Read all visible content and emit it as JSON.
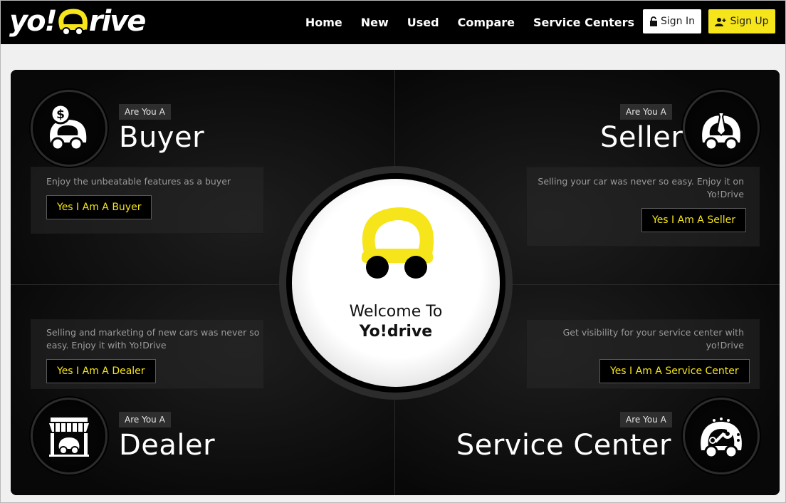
{
  "header": {
    "logo_text_1": "yo!",
    "logo_text_2": "rive",
    "nav": [
      "Home",
      "New",
      "Used",
      "Compare",
      "Service Centers"
    ],
    "sign_in": "Sign In",
    "sign_up": "Sign Up"
  },
  "colors": {
    "accent": "#f5e51a",
    "background": "#000000"
  },
  "roles": {
    "buyer": {
      "tag": "Are You A",
      "title": "Buyer",
      "desc": "Enjoy the unbeatable features as a buyer",
      "cta": "Yes I Am A Buyer",
      "icon": "buyer-car-dollar-icon"
    },
    "seller": {
      "tag": "Are You A",
      "title": "Seller",
      "desc": "Selling your car was never so easy. Enjoy it on Yo!Drive",
      "cta": "Yes I Am A Seller",
      "icon": "seller-car-tie-icon"
    },
    "dealer": {
      "tag": "Are You A",
      "title": "Dealer",
      "desc": "Selling and marketing of new cars was never so easy. Enjoy it with Yo!Drive",
      "cta": "Yes I Am A Dealer",
      "icon": "dealer-shop-icon"
    },
    "service": {
      "tag": "Are You A",
      "title": "Service Center",
      "desc": "Get visibility for your service center with yo!Drive",
      "cta": "Yes I Am A Service Center",
      "icon": "service-car-wrench-icon"
    }
  },
  "center": {
    "line1": "Welcome To",
    "line2": "Yo!drive"
  }
}
